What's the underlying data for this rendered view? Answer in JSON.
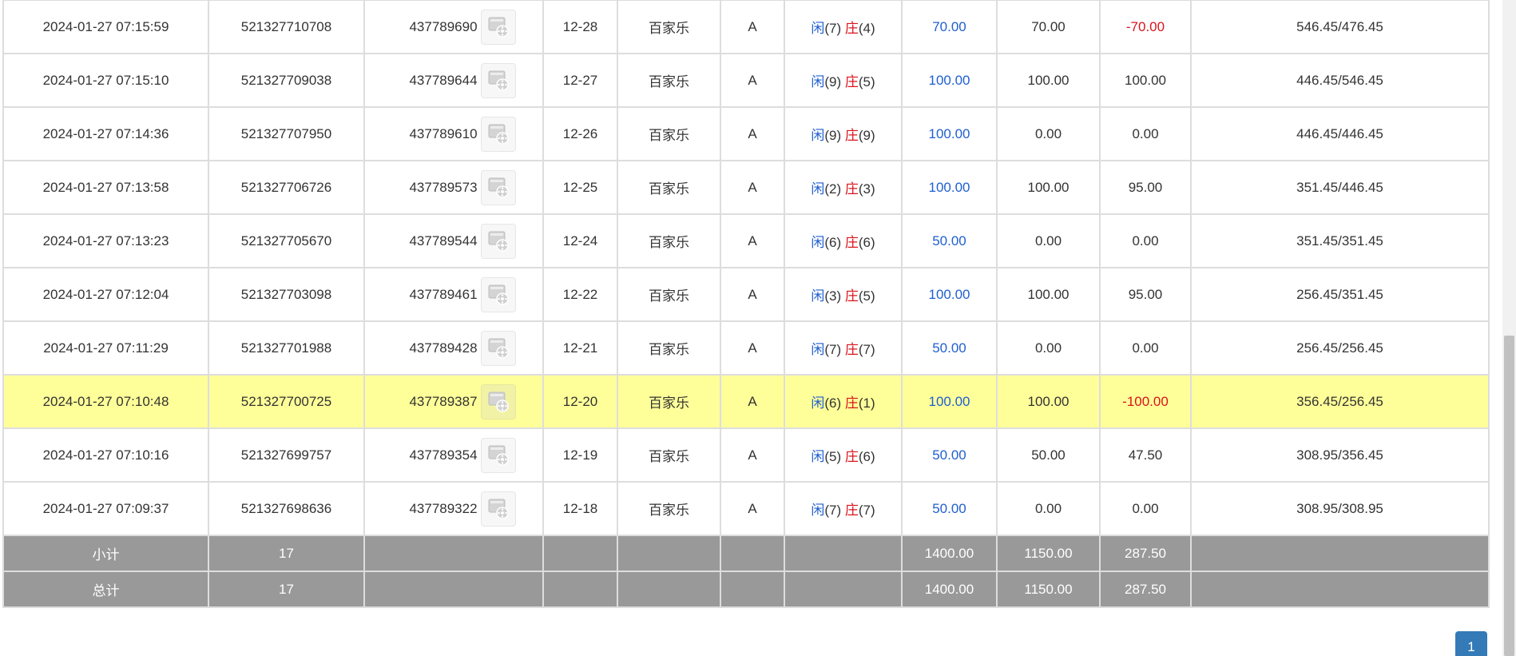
{
  "table": {
    "rows": [
      {
        "time": "2024-01-27 07:15:59",
        "bet_id": "521327710708",
        "round_id": "437789690",
        "shoe": "12-28",
        "game": "百家乐",
        "table": "A",
        "player_label": "闲",
        "player_points": "(7)",
        "banker_label": "庄",
        "banker_points": "(4)",
        "bet": "70.00",
        "valid": "70.00",
        "win": "-70.00",
        "win_negative": true,
        "balance": "546.45/476.45",
        "highlight": false
      },
      {
        "time": "2024-01-27 07:15:10",
        "bet_id": "521327709038",
        "round_id": "437789644",
        "shoe": "12-27",
        "game": "百家乐",
        "table": "A",
        "player_label": "闲",
        "player_points": "(9)",
        "banker_label": "庄",
        "banker_points": "(5)",
        "bet": "100.00",
        "valid": "100.00",
        "win": "100.00",
        "win_negative": false,
        "balance": "446.45/546.45",
        "highlight": false
      },
      {
        "time": "2024-01-27 07:14:36",
        "bet_id": "521327707950",
        "round_id": "437789610",
        "shoe": "12-26",
        "game": "百家乐",
        "table": "A",
        "player_label": "闲",
        "player_points": "(9)",
        "banker_label": "庄",
        "banker_points": "(9)",
        "bet": "100.00",
        "valid": "0.00",
        "win": "0.00",
        "win_negative": false,
        "balance": "446.45/446.45",
        "highlight": false
      },
      {
        "time": "2024-01-27 07:13:58",
        "bet_id": "521327706726",
        "round_id": "437789573",
        "shoe": "12-25",
        "game": "百家乐",
        "table": "A",
        "player_label": "闲",
        "player_points": "(2)",
        "banker_label": "庄",
        "banker_points": "(3)",
        "bet": "100.00",
        "valid": "100.00",
        "win": "95.00",
        "win_negative": false,
        "balance": "351.45/446.45",
        "highlight": false
      },
      {
        "time": "2024-01-27 07:13:23",
        "bet_id": "521327705670",
        "round_id": "437789544",
        "shoe": "12-24",
        "game": "百家乐",
        "table": "A",
        "player_label": "闲",
        "player_points": "(6)",
        "banker_label": "庄",
        "banker_points": "(6)",
        "bet": "50.00",
        "valid": "0.00",
        "win": "0.00",
        "win_negative": false,
        "balance": "351.45/351.45",
        "highlight": false
      },
      {
        "time": "2024-01-27 07:12:04",
        "bet_id": "521327703098",
        "round_id": "437789461",
        "shoe": "12-22",
        "game": "百家乐",
        "table": "A",
        "player_label": "闲",
        "player_points": "(3)",
        "banker_label": "庄",
        "banker_points": "(5)",
        "bet": "100.00",
        "valid": "100.00",
        "win": "95.00",
        "win_negative": false,
        "balance": "256.45/351.45",
        "highlight": false
      },
      {
        "time": "2024-01-27 07:11:29",
        "bet_id": "521327701988",
        "round_id": "437789428",
        "shoe": "12-21",
        "game": "百家乐",
        "table": "A",
        "player_label": "闲",
        "player_points": "(7)",
        "banker_label": "庄",
        "banker_points": "(7)",
        "bet": "50.00",
        "valid": "0.00",
        "win": "0.00",
        "win_negative": false,
        "balance": "256.45/256.45",
        "highlight": false
      },
      {
        "time": "2024-01-27 07:10:48",
        "bet_id": "521327700725",
        "round_id": "437789387",
        "shoe": "12-20",
        "game": "百家乐",
        "table": "A",
        "player_label": "闲",
        "player_points": "(6)",
        "banker_label": "庄",
        "banker_points": "(1)",
        "bet": "100.00",
        "valid": "100.00",
        "win": "-100.00",
        "win_negative": true,
        "balance": "356.45/256.45",
        "highlight": true
      },
      {
        "time": "2024-01-27 07:10:16",
        "bet_id": "521327699757",
        "round_id": "437789354",
        "shoe": "12-19",
        "game": "百家乐",
        "table": "A",
        "player_label": "闲",
        "player_points": "(5)",
        "banker_label": "庄",
        "banker_points": "(6)",
        "bet": "50.00",
        "valid": "50.00",
        "win": "47.50",
        "win_negative": false,
        "balance": "308.95/356.45",
        "highlight": false
      },
      {
        "time": "2024-01-27 07:09:37",
        "bet_id": "521327698636",
        "round_id": "437789322",
        "shoe": "12-18",
        "game": "百家乐",
        "table": "A",
        "player_label": "闲",
        "player_points": "(7)",
        "banker_label": "庄",
        "banker_points": "(7)",
        "bet": "50.00",
        "valid": "0.00",
        "win": "0.00",
        "win_negative": false,
        "balance": "308.95/308.95",
        "highlight": false
      }
    ],
    "subtotal": {
      "label": "小计",
      "count": "17",
      "bet": "1400.00",
      "valid": "1150.00",
      "win": "287.50"
    },
    "total": {
      "label": "总计",
      "count": "17",
      "bet": "1400.00",
      "valid": "1150.00",
      "win": "287.50"
    }
  },
  "icons": {
    "replay": "video-replay-icon"
  },
  "colors": {
    "player": "#1f5fd0",
    "banker": "#d9141b",
    "highlight_row": "#ffff99",
    "total_row": "#999999",
    "pagination_active": "#337ab7"
  },
  "pagination": {
    "pages": [
      "1"
    ],
    "current": "1"
  }
}
